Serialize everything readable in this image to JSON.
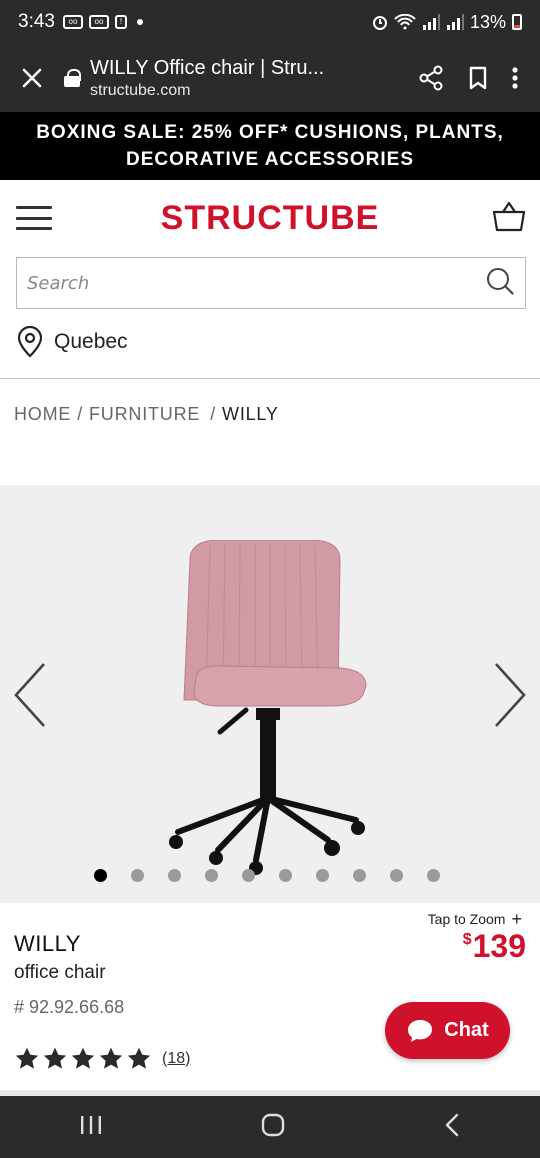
{
  "status_bar": {
    "time": "3:43",
    "battery": "13%"
  },
  "browser": {
    "page_title": "WILLY Office chair | Stru...",
    "domain": "structube.com"
  },
  "promo": {
    "text": "BOXING SALE: 25% OFF* CUSHIONS, PLANTS, DECORATIVE ACCESSORIES"
  },
  "header": {
    "logo": "STRUCTUBE"
  },
  "search": {
    "placeholder": "Search"
  },
  "location": {
    "label": "Quebec"
  },
  "breadcrumb": {
    "home": "HOME",
    "sep1": "/",
    "furniture": "FURNITURE",
    "sep2": "/",
    "current": "WILLY"
  },
  "gallery": {
    "dot_count": 10,
    "active_index": 0
  },
  "product": {
    "zoom_label": "Tap to Zoom",
    "zoom_plus": "+",
    "name": "WILLY",
    "subtitle": "office chair",
    "sku": "# 92.92.66.68",
    "price_currency": "$",
    "price": "139",
    "rating_stars": 5,
    "reviews": "(18)"
  },
  "chat": {
    "label": "Chat"
  },
  "colors": {
    "brand_red": "#d0112b",
    "chair_pink": "#d49aa4",
    "dark_bar": "#2b2b2b"
  }
}
